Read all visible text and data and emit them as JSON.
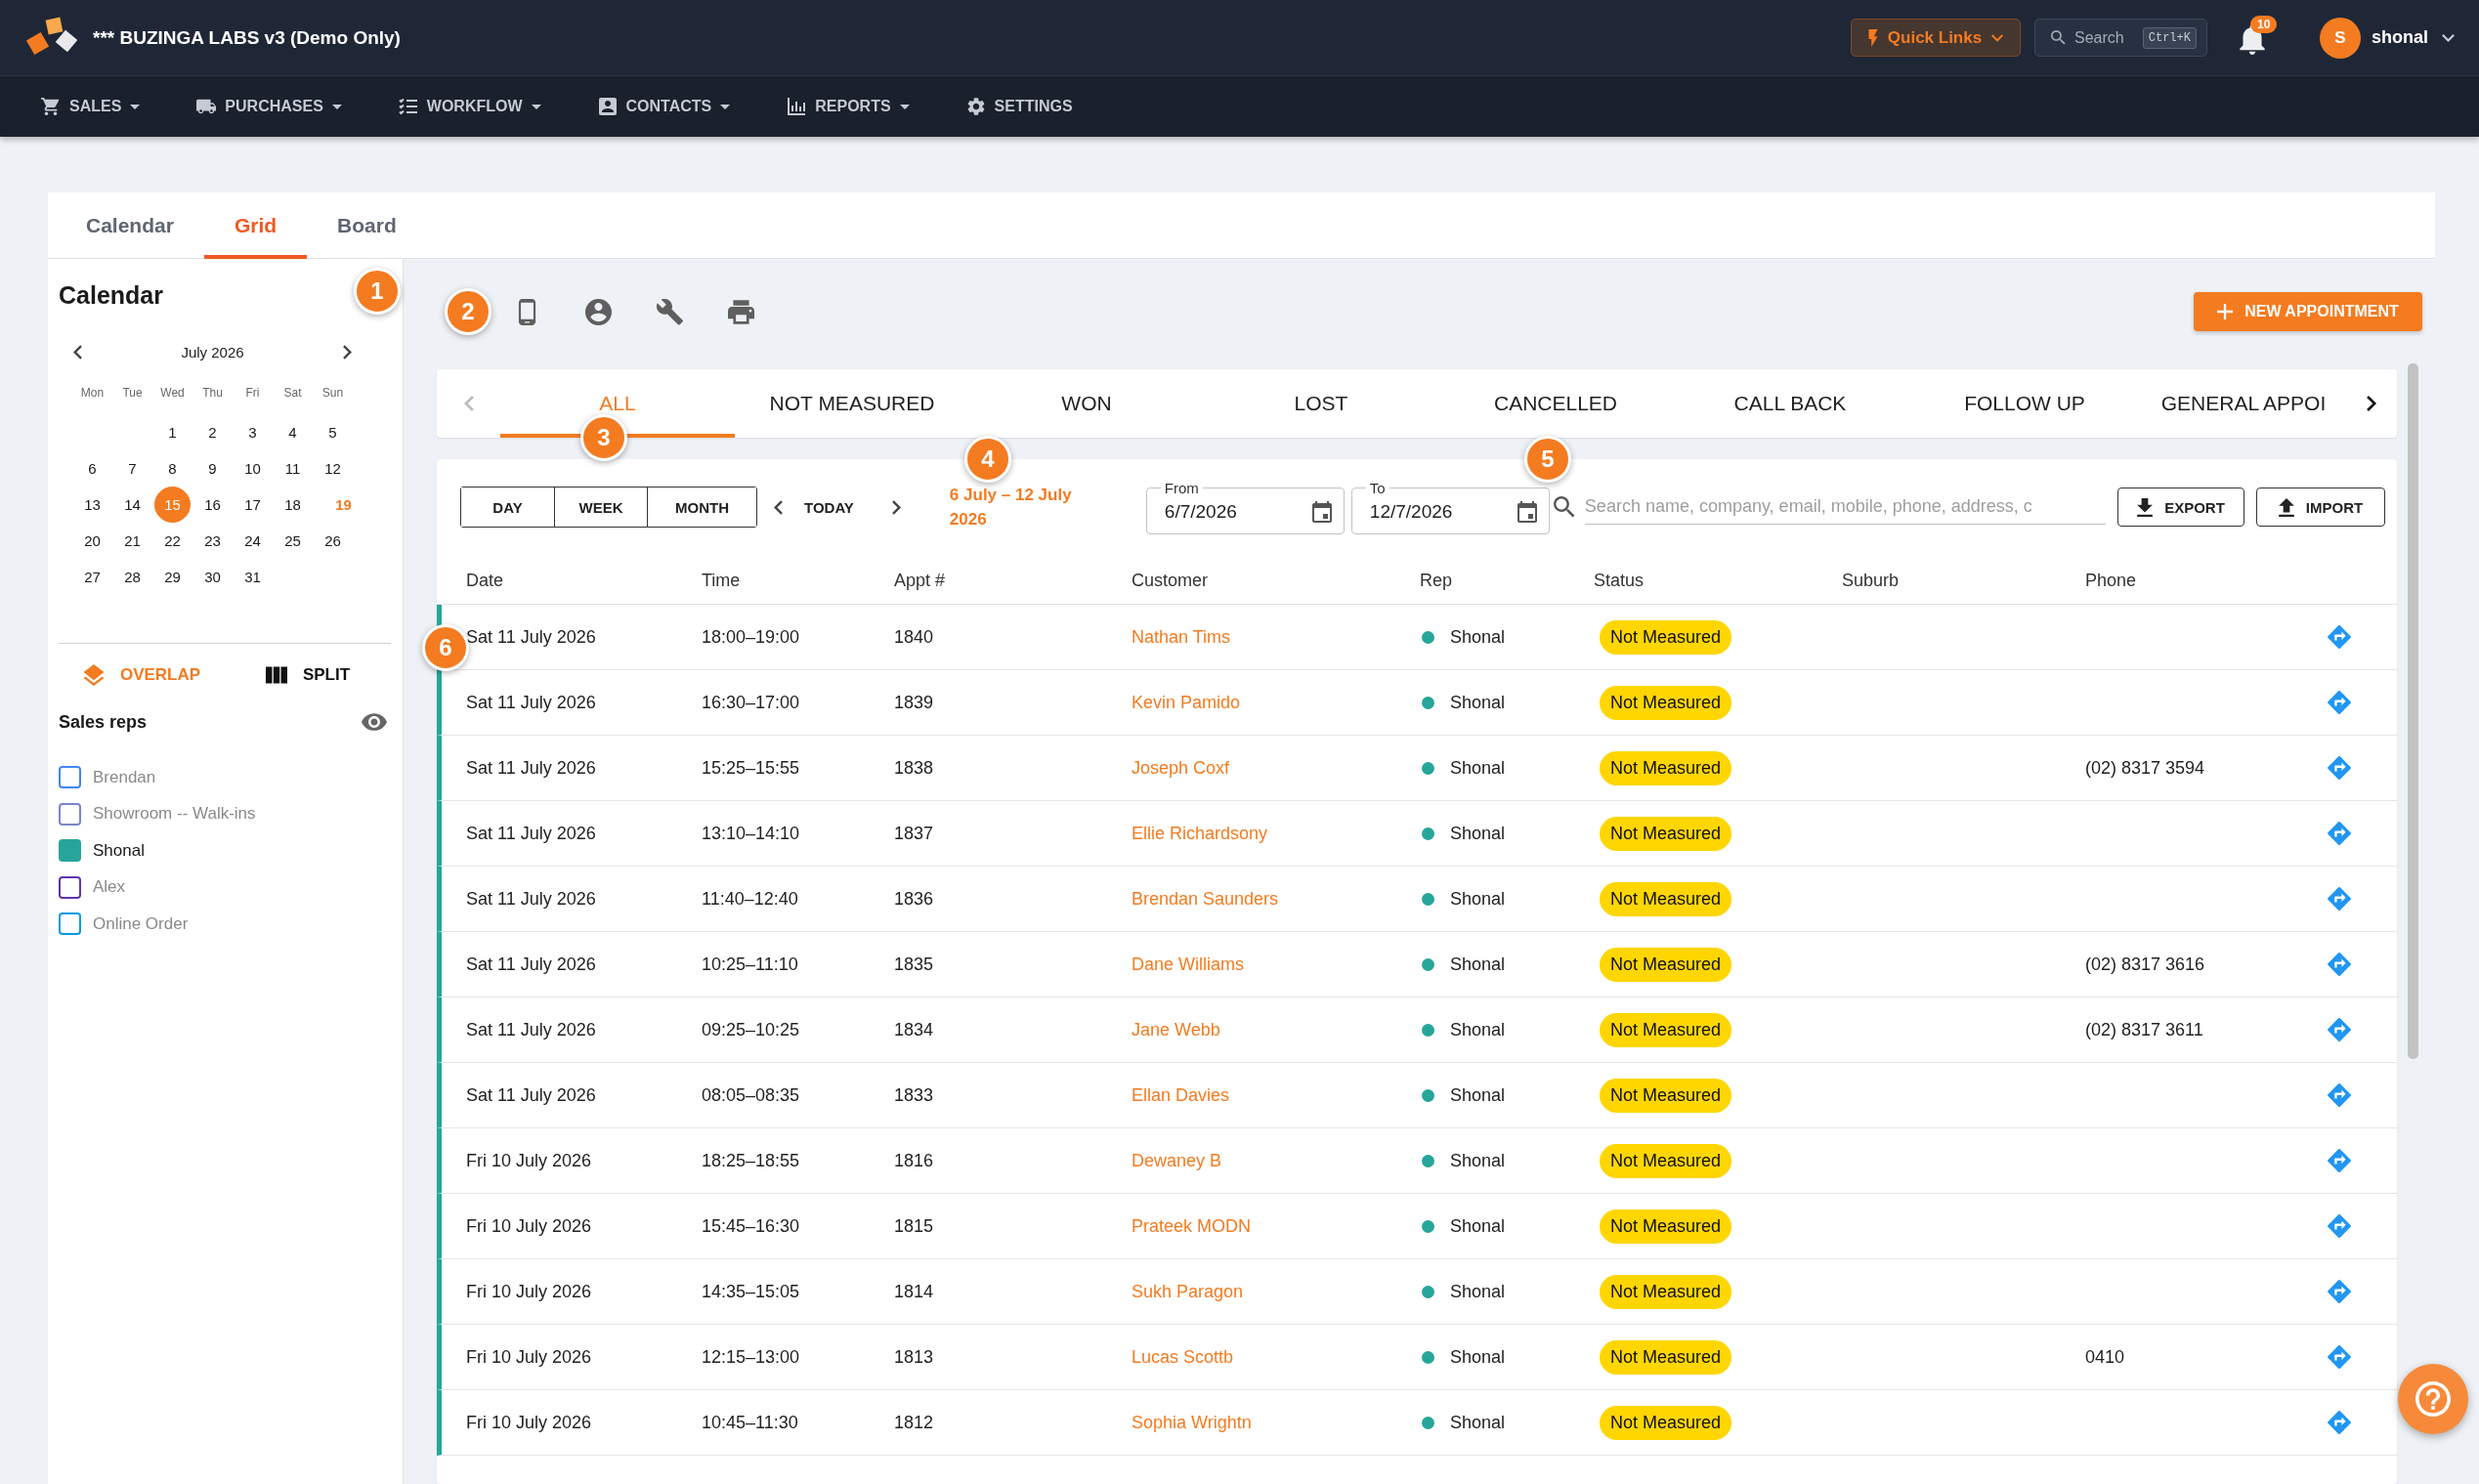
{
  "header": {
    "title": "*** BUZINGA LABS v3 (Demo Only)",
    "quick_links": "Quick Links",
    "search": {
      "label": "Search",
      "shortcut": "Ctrl+K"
    },
    "notification_count": "10",
    "user": {
      "initial": "S",
      "name": "shonal"
    }
  },
  "nav": [
    {
      "label": "SALES",
      "kind": "cart",
      "dropdown": true
    },
    {
      "label": "PURCHASES",
      "kind": "truck",
      "dropdown": true
    },
    {
      "label": "WORKFLOW",
      "kind": "tasks",
      "dropdown": true
    },
    {
      "label": "CONTACTS",
      "kind": "contacts",
      "dropdown": true
    },
    {
      "label": "REPORTS",
      "kind": "chart",
      "dropdown": true
    },
    {
      "label": "SETTINGS",
      "kind": "gear",
      "dropdown": false
    }
  ],
  "view_tabs": [
    {
      "label": "Calendar",
      "selected": false
    },
    {
      "label": "Grid",
      "selected": true
    },
    {
      "label": "Board",
      "selected": false
    }
  ],
  "calendar": {
    "title": "Calendar",
    "month": "July 2026",
    "weekdays": [
      "Mon",
      "Tue",
      "Wed",
      "Thu",
      "Fri",
      "Sat",
      "Sun"
    ],
    "weeks": [
      {
        "days": [
          {
            "label": "1",
            "selected": false,
            "today": false
          },
          {
            "label": "2",
            "selected": false,
            "today": false
          },
          {
            "label": "3",
            "selected": false,
            "today": false
          },
          {
            "label": "4",
            "selected": false,
            "today": false
          },
          {
            "label": "5",
            "selected": false,
            "today": false
          }
        ]
      },
      {
        "days": [
          {
            "label": "6",
            "selected": false,
            "today": false
          },
          {
            "label": "7",
            "selected": false,
            "today": false
          },
          {
            "label": "8",
            "selected": false,
            "today": false
          },
          {
            "label": "9",
            "selected": false,
            "today": false
          },
          {
            "label": "10",
            "selected": false,
            "today": false
          },
          {
            "label": "11",
            "selected": false,
            "today": false
          },
          {
            "label": "12",
            "selected": false,
            "today": false
          }
        ]
      },
      {
        "days": [
          {
            "label": "13",
            "selected": false,
            "today": false
          },
          {
            "label": "14",
            "selected": false,
            "today": false
          },
          {
            "label": "15",
            "selected": true,
            "today": false
          },
          {
            "label": "16",
            "selected": false,
            "today": false
          },
          {
            "label": "17",
            "selected": false,
            "today": false
          },
          {
            "label": "18",
            "selected": false,
            "today": false
          },
          {
            "label": "19",
            "selected": false,
            "today": true
          }
        ]
      },
      {
        "days": [
          {
            "label": "20",
            "selected": false,
            "today": false
          },
          {
            "label": "21",
            "selected": false,
            "today": false
          },
          {
            "label": "22",
            "selected": false,
            "today": false
          },
          {
            "label": "23",
            "selected": false,
            "today": false
          },
          {
            "label": "24",
            "selected": false,
            "today": false
          },
          {
            "label": "25",
            "selected": false,
            "today": false
          },
          {
            "label": "26",
            "selected": false,
            "today": false
          }
        ]
      },
      {
        "days": [
          {
            "label": "27",
            "selected": false,
            "today": false
          },
          {
            "label": "28",
            "selected": false,
            "today": false
          },
          {
            "label": "29",
            "selected": false,
            "today": false
          },
          {
            "label": "30",
            "selected": false,
            "today": false
          },
          {
            "label": "31",
            "selected": false,
            "today": false
          }
        ]
      }
    ]
  },
  "layout_toggle": [
    {
      "label": "OVERLAP",
      "kind": "overlap",
      "selected": true
    },
    {
      "label": "SPLIT",
      "kind": "split",
      "selected": false
    }
  ],
  "sales_reps": {
    "title": "Sales reps",
    "reps": [
      {
        "name": "Brendan",
        "checked": false,
        "color": "#4285f4"
      },
      {
        "name": "Showroom -- Walk-ins",
        "checked": false,
        "color": "#7986cb"
      },
      {
        "name": "Shonal",
        "checked": true,
        "color": "#26a69a"
      },
      {
        "name": "Alex",
        "checked": false,
        "color": "#5e35b1"
      },
      {
        "name": "Online Order",
        "checked": false,
        "color": "#039be5"
      }
    ]
  },
  "tour_markers": [
    "1",
    "2",
    "3",
    "4",
    "5",
    "6"
  ],
  "new_appointment": "NEW APPOINTMENT",
  "status_tabs": [
    {
      "label": "ALL",
      "selected": true
    },
    {
      "label": "NOT MEASURED",
      "selected": false
    },
    {
      "label": "WON",
      "selected": false
    },
    {
      "label": "LOST",
      "selected": false
    },
    {
      "label": "CANCELLED",
      "selected": false
    },
    {
      "label": "CALL BACK",
      "selected": false
    },
    {
      "label": "FOLLOW UP",
      "selected": false
    },
    {
      "label": "GENERAL APPOI",
      "selected": false
    }
  ],
  "filters": {
    "ranges": [
      "DAY",
      "WEEK",
      "MONTH"
    ],
    "today": "TODAY",
    "range_label": "6 July – 12 July 2026",
    "from": {
      "label": "From",
      "value": "6/7/2026"
    },
    "to": {
      "label": "To",
      "value": "12/7/2026"
    },
    "search": {
      "placeholder": "Search name, company, email, mobile, phone, address, c"
    },
    "export": "EXPORT",
    "import": "IMPORT"
  },
  "table": {
    "columns": [
      "Date",
      "Time",
      "Appt #",
      "Customer",
      "Rep",
      "Status",
      "Suburb",
      "Phone"
    ],
    "rows": [
      {
        "date": "Sat 11 July 2026",
        "time": "18:00–19:00",
        "appt": "1840",
        "customer": "Nathan Tims",
        "rep": {
          "name": "Shonal",
          "color": "#26a69a"
        },
        "status": {
          "label": "Not Measured",
          "color": "#ffd600"
        }
      },
      {
        "date": "Sat 11 July 2026",
        "time": "16:30–17:00",
        "appt": "1839",
        "customer": "Kevin Pamido",
        "rep": {
          "name": "Shonal",
          "color": "#26a69a"
        },
        "status": {
          "label": "Not Measured",
          "color": "#ffd600"
        }
      },
      {
        "date": "Sat 11 July 2026",
        "time": "15:25–15:55",
        "appt": "1838",
        "customer": "Joseph Coxf",
        "rep": {
          "name": "Shonal",
          "color": "#26a69a"
        },
        "status": {
          "label": "Not Measured",
          "color": "#ffd600"
        },
        "phone": "(02) 8317 3594"
      },
      {
        "date": "Sat 11 July 2026",
        "time": "13:10–14:10",
        "appt": "1837",
        "customer": "Ellie Richardsony",
        "rep": {
          "name": "Shonal",
          "color": "#26a69a"
        },
        "status": {
          "label": "Not Measured",
          "color": "#ffd600"
        }
      },
      {
        "date": "Sat 11 July 2026",
        "time": "11:40–12:40",
        "appt": "1836",
        "customer": "Brendan Saunders",
        "rep": {
          "name": "Shonal",
          "color": "#26a69a"
        },
        "status": {
          "label": "Not Measured",
          "color": "#ffd600"
        }
      },
      {
        "date": "Sat 11 July 2026",
        "time": "10:25–11:10",
        "appt": "1835",
        "customer": "Dane Williams",
        "rep": {
          "name": "Shonal",
          "color": "#26a69a"
        },
        "status": {
          "label": "Not Measured",
          "color": "#ffd600"
        },
        "phone": "(02) 8317 3616"
      },
      {
        "date": "Sat 11 July 2026",
        "time": "09:25–10:25",
        "appt": "1834",
        "customer": "Jane Webb",
        "rep": {
          "name": "Shonal",
          "color": "#26a69a"
        },
        "status": {
          "label": "Not Measured",
          "color": "#ffd600"
        },
        "phone": "(02) 8317 3611"
      },
      {
        "date": "Sat 11 July 2026",
        "time": "08:05–08:35",
        "appt": "1833",
        "customer": "Ellan Davies",
        "rep": {
          "name": "Shonal",
          "color": "#26a69a"
        },
        "status": {
          "label": "Not Measured",
          "color": "#ffd600"
        }
      },
      {
        "date": "Fri 10 July 2026",
        "time": "18:25–18:55",
        "appt": "1816",
        "customer": "Dewaney B",
        "rep": {
          "name": "Shonal",
          "color": "#26a69a"
        },
        "status": {
          "label": "Not Measured",
          "color": "#ffd600"
        }
      },
      {
        "date": "Fri 10 July 2026",
        "time": "15:45–16:30",
        "appt": "1815",
        "customer": "Prateek MODN",
        "rep": {
          "name": "Shonal",
          "color": "#26a69a"
        },
        "status": {
          "label": "Not Measured",
          "color": "#ffd600"
        }
      },
      {
        "date": "Fri 10 July 2026",
        "time": "14:35–15:05",
        "appt": "1814",
        "customer": "Sukh Paragon",
        "rep": {
          "name": "Shonal",
          "color": "#26a69a"
        },
        "status": {
          "label": "Not Measured",
          "color": "#ffd600"
        }
      },
      {
        "date": "Fri 10 July 2026",
        "time": "12:15–13:00",
        "appt": "1813",
        "customer": "Lucas Scottb",
        "rep": {
          "name": "Shonal",
          "color": "#26a69a"
        },
        "status": {
          "label": "Not Measured",
          "color": "#ffd600"
        },
        "phone": "0410"
      },
      {
        "date": "Fri 10 July 2026",
        "time": "10:45–11:30",
        "appt": "1812",
        "customer": "Sophia Wrightn",
        "rep": {
          "name": "Shonal",
          "color": "#26a69a"
        },
        "status": {
          "label": "Not Measured",
          "color": "#ffd600"
        }
      }
    ]
  }
}
